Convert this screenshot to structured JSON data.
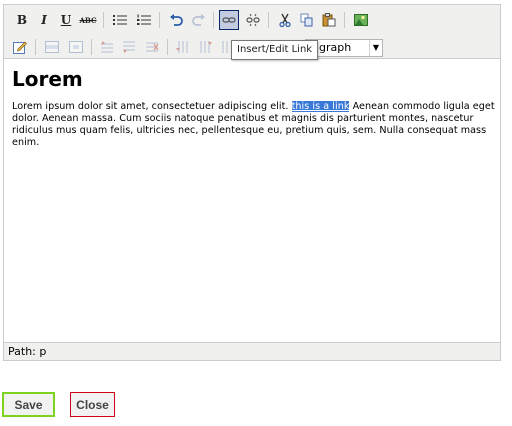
{
  "editor": {
    "toolbar_row1": [
      {
        "name": "bold-button",
        "icon": "bold-icon",
        "glyph": "B",
        "state": "normal"
      },
      {
        "name": "italic-button",
        "icon": "italic-icon",
        "glyph": "I",
        "state": "normal"
      },
      {
        "name": "underline-button",
        "icon": "underline-icon",
        "glyph": "U",
        "state": "normal"
      },
      {
        "name": "strikethrough-button",
        "icon": "strikethrough-icon",
        "glyph": "ABC",
        "state": "normal"
      },
      {
        "name": "bullet-list-button",
        "icon": "bullet-list-icon",
        "state": "normal"
      },
      {
        "name": "numbered-list-button",
        "icon": "numbered-list-icon",
        "state": "normal"
      },
      {
        "name": "undo-button",
        "icon": "undo-icon",
        "state": "normal"
      },
      {
        "name": "redo-button",
        "icon": "redo-icon",
        "state": "disabled"
      },
      {
        "name": "insert-link-button",
        "icon": "link-icon",
        "state": "active"
      },
      {
        "name": "unlink-button",
        "icon": "unlink-icon",
        "state": "normal"
      },
      {
        "name": "cut-button",
        "icon": "scissors-icon",
        "state": "normal"
      },
      {
        "name": "copy-button",
        "icon": "copy-icon",
        "state": "normal"
      },
      {
        "name": "paste-button",
        "icon": "paste-icon",
        "state": "normal"
      },
      {
        "name": "insert-image-button",
        "icon": "image-icon",
        "state": "normal"
      }
    ],
    "tooltip": "Insert/Edit Link",
    "format_select": {
      "visible_value": "graph"
    },
    "content": {
      "heading": "Lorem",
      "paragraph_before": "Lorem ipsum dolor sit amet, consectetuer adipiscing elit. ",
      "link_text": "this is a link",
      "paragraph_after": " Aenean commodo ligula eget dolor. Aenean massa. Cum sociis natoque penatibus et magnis dis parturient montes, nascetur ridiculus mus quam felis, ultricies nec, pellentesque eu, pretium quis, sem. Nulla consequat mass enim."
    },
    "path": "Path: p"
  },
  "actions": {
    "save_label": "Save",
    "close_label": "Close"
  },
  "colors": {
    "toolbar_bg": "#f0f0ee",
    "selection": "#3a78d8",
    "save_border": "#7ed321",
    "close_border": "#d0021b"
  }
}
